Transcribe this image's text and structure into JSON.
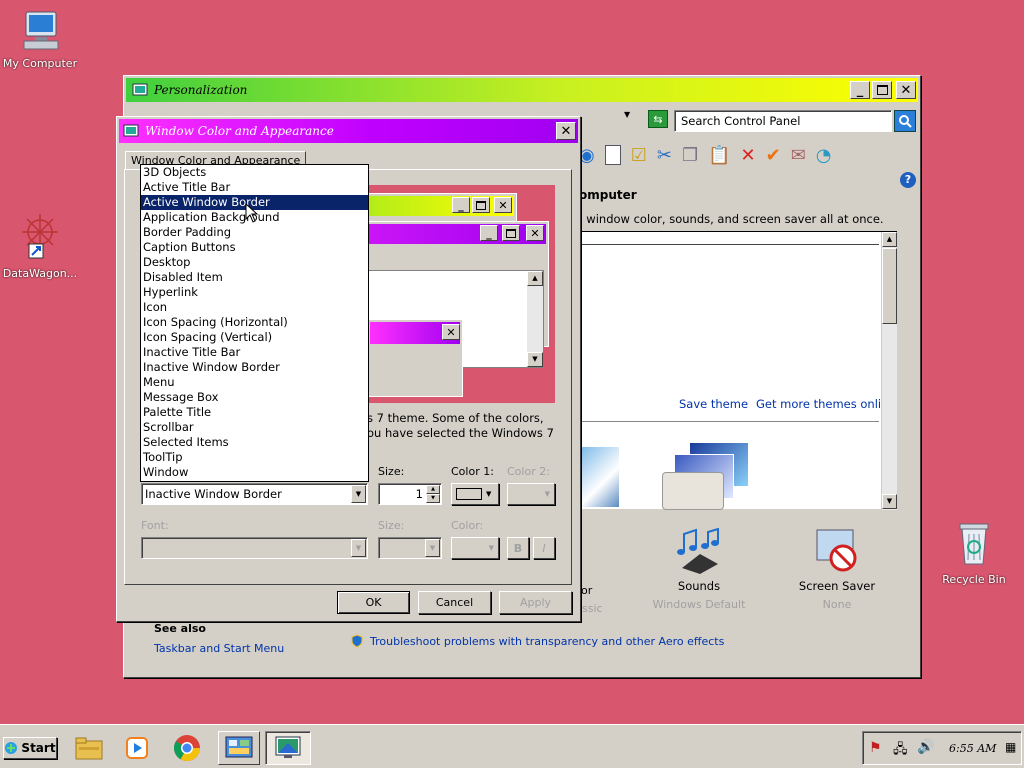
{
  "desktop": {
    "my_computer": "My Computer",
    "datawagon": "DataWagon...",
    "recycle_bin": "Recycle Bin"
  },
  "personalization": {
    "title": "Personalization",
    "search_placeholder": "Search Control Panel",
    "heading_partial": "omputer",
    "desc_partial": ", window color, sounds, and screen saver all at once.",
    "save_theme": "Save theme",
    "get_more_themes": "Get more themes online",
    "color_label_partial": "or",
    "color_sub_partial": "ssic",
    "sounds_label": "Sounds",
    "sounds_sub": "Windows Default",
    "screensaver_label": "Screen Saver",
    "screensaver_sub": "None",
    "see_also": "See also",
    "taskbar_link": "Taskbar and Start Menu",
    "troubleshoot_link": "Troubleshoot problems with transparency and other Aero effects"
  },
  "dialog": {
    "title": "Window Color and Appearance",
    "tab": "Window Color and Appearance",
    "info_line1": "s 7 theme.  Some of the colors,",
    "info_line2": "ou have selected the Windows 7",
    "size_label": "Size:",
    "color1_label": "Color 1:",
    "color2_label": "Color 2:",
    "item_value": "Inactive Window Border",
    "size_value": "1",
    "font_label": "Font:",
    "font_size_label": "Size:",
    "font_color_label": "Color:",
    "bold_label": "B",
    "italic_label": "I",
    "ok": "OK",
    "cancel": "Cancel",
    "apply": "Apply"
  },
  "item_list": {
    "selected": "Active Window Border",
    "options": [
      "3D Objects",
      "Active Title Bar",
      "Active Window Border",
      "Application Background",
      "Border Padding",
      "Caption Buttons",
      "Desktop",
      "Disabled Item",
      "Hyperlink",
      "Icon",
      "Icon Spacing (Horizontal)",
      "Icon Spacing (Vertical)",
      "Inactive Title Bar",
      "Inactive Window Border",
      "Menu",
      "Message Box",
      "Palette Title",
      "Scrollbar",
      "Selected Items",
      "ToolTip",
      "Window"
    ]
  },
  "taskbar": {
    "start": "Start",
    "clock": "6:55 AM"
  },
  "colors": {
    "desktop": "#d9566f",
    "selection": "#0a246a",
    "active_title_gradient": "green-yellow",
    "dialog_title_gradient": "magenta-purple"
  }
}
